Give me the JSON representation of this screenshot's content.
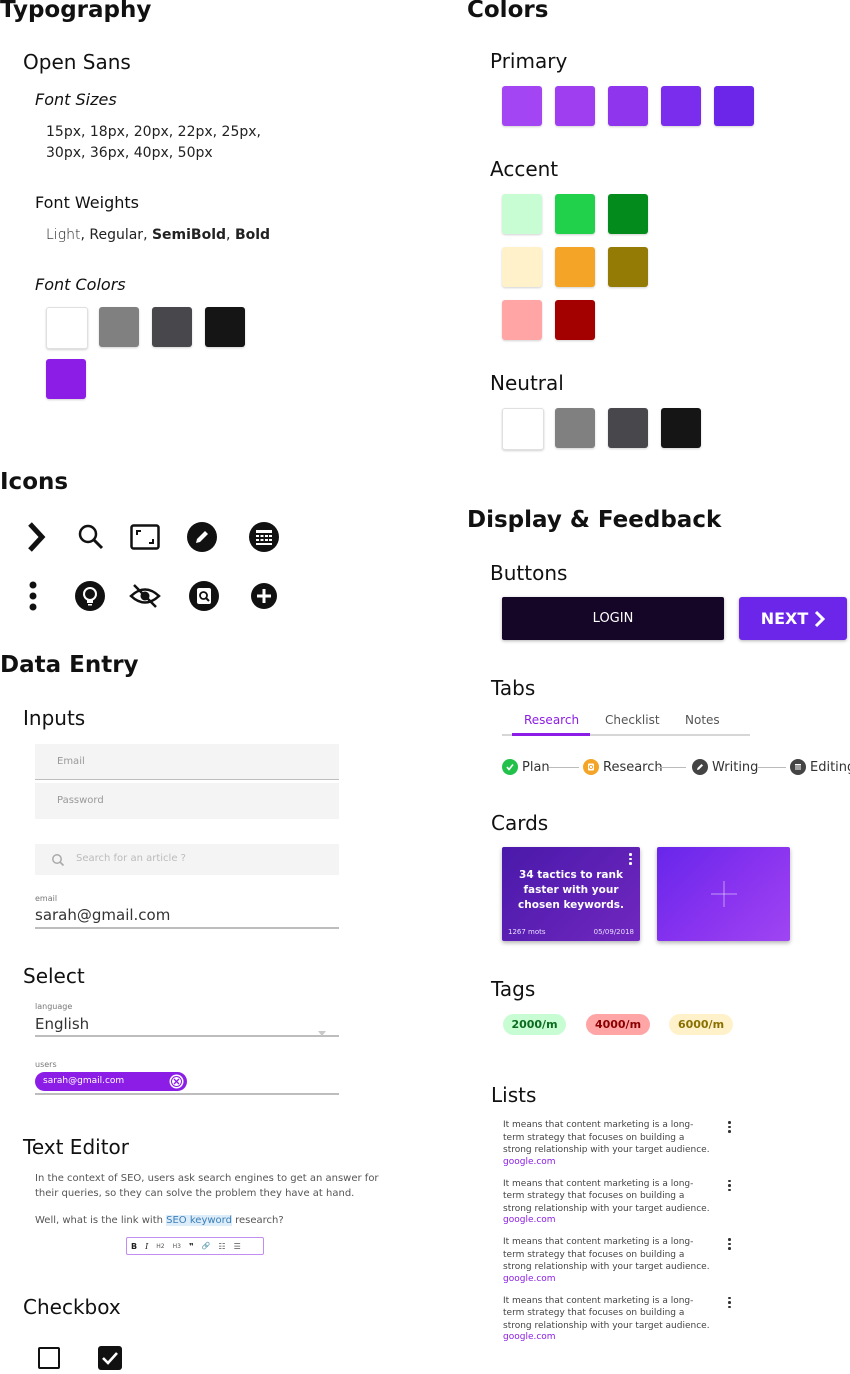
{
  "typography": {
    "title": "Typography",
    "font_name": "Open Sans",
    "sizes_title": "Font Sizes",
    "sizes_line1": "15px, 18px, 20px, 22px, 25px,",
    "sizes_line2": "30px, 36px, 40px, 50px",
    "weights_title": "Font Weights",
    "weights": {
      "light": "Light",
      "regular": "Regular",
      "semibold": "SemiBold",
      "bold": "Bold",
      "sep": ", "
    },
    "colors_title": "Font Colors",
    "colors": [
      "#ffffff",
      "#808080",
      "#48484c",
      "#151515",
      "#8b1de6"
    ]
  },
  "colors": {
    "title": "Colors",
    "primary_title": "Primary",
    "primary": [
      "#a345f2",
      "#9e3ef0",
      "#8f35ee",
      "#7b2ded",
      "#6b26ea"
    ],
    "accent_title": "Accent",
    "accent_rows": [
      [
        "#c8fdd4",
        "#22d14b",
        "#038b1c"
      ],
      [
        "#fff1c9",
        "#f4a527",
        "#937b05"
      ],
      [
        "#ffa5a5",
        "#a30000"
      ]
    ],
    "neutral_title": "Neutral",
    "neutral": [
      "#ffffff",
      "#808080",
      "#48484c",
      "#151515"
    ]
  },
  "icons": {
    "title": "Icons",
    "row1": [
      "chevron-right-icon",
      "search-icon",
      "fullscreen-icon",
      "edit-pencil-icon",
      "calculator-icon"
    ],
    "row2": [
      "more-vertical-icon",
      "lightbulb-icon",
      "eye-off-icon",
      "inspect-icon",
      "add-circle-icon"
    ]
  },
  "data_entry": {
    "title": "Data Entry",
    "inputs_title": "Inputs",
    "email_placeholder": "Email",
    "password_placeholder": "Password",
    "search_placeholder": "Search for an article ?",
    "email_label": "email",
    "email_value": "sarah@gmail.com",
    "select_title": "Select",
    "language_label": "language",
    "language_value": "English",
    "users_label": "users",
    "user_chip": "sarah@gmail.com",
    "editor_title": "Text Editor",
    "editor_para": "In the context of SEO, users ask search engines to get an answer for their queries, so they can solve the problem they have at hand.",
    "editor_line_before": "Well, what is the link with ",
    "editor_highlight": "SEO keyword",
    "editor_line_after": " research?",
    "toolbar": {
      "bold": "B",
      "italic": "I",
      "h2": "H2",
      "h3": "H3",
      "quote": "❞",
      "link": "🔗",
      "ol": "☷",
      "ul": "☰"
    },
    "checkbox_title": "Checkbox"
  },
  "display": {
    "title": "Display & Feedback",
    "buttons_title": "Buttons",
    "login_label": "LOGIN",
    "next_label": "NEXT",
    "tabs_title": "Tabs",
    "tabs": [
      "Research",
      "Checklist",
      "Notes"
    ],
    "active_tab": "Research",
    "steps": [
      "Plan",
      "Research",
      "Writing",
      "Editing"
    ],
    "cards_title": "Cards",
    "card_text": "34 tactics to rank faster with your chosen keywords.",
    "card_words": "1267 mots",
    "card_date": "05/09/2018",
    "tags_title": "Tags",
    "tags": [
      {
        "label": "2000/m",
        "bg": "#c8fdd4",
        "fg": "#0b6b1e"
      },
      {
        "label": "4000/m",
        "bg": "#ffa5a5",
        "fg": "#8a0000"
      },
      {
        "label": "6000/m",
        "bg": "#fff1c9",
        "fg": "#8a7000"
      }
    ],
    "lists_title": "Lists",
    "list_items": [
      {
        "text": "It means that content marketing is a long-term strategy that focuses on building a strong relationship with your target audience.",
        "link": "google.com"
      },
      {
        "text": "It means that content marketing is a long-term strategy that focuses on building a strong relationship with your target audience.",
        "link": "google.com"
      },
      {
        "text": "It means that content marketing is a long-term strategy that focuses on building a strong relationship with your target audience.",
        "link": "google.com"
      },
      {
        "text": "It means that content marketing is a long-term strategy that focuses on building a strong relationship with your target audience.",
        "link": "google.com"
      }
    ]
  },
  "accent_color": "#8b1de6"
}
